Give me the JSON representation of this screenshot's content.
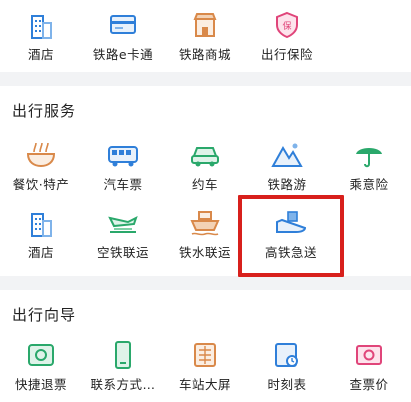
{
  "top_row": [
    {
      "label": "酒店",
      "icon": "hotel-icon"
    },
    {
      "label": "铁路e卡通",
      "icon": "railway-card-icon"
    },
    {
      "label": "铁路商城",
      "icon": "railway-mall-icon"
    },
    {
      "label": "出行保险",
      "icon": "travel-insurance-icon"
    }
  ],
  "travel_services": {
    "title": "出行服务",
    "row1": [
      {
        "label": "餐饮·特产",
        "icon": "food-icon"
      },
      {
        "label": "汽车票",
        "icon": "bus-ticket-icon"
      },
      {
        "label": "约车",
        "icon": "car-icon"
      },
      {
        "label": "铁路游",
        "icon": "railway-tour-icon"
      },
      {
        "label": "乘意险",
        "icon": "umbrella-icon"
      }
    ],
    "row2": [
      {
        "label": "酒店",
        "icon": "hotel-icon"
      },
      {
        "label": "空铁联运",
        "icon": "air-rail-icon"
      },
      {
        "label": "铁水联运",
        "icon": "rail-water-icon"
      },
      {
        "label": "高铁急送",
        "icon": "express-delivery-icon"
      }
    ]
  },
  "travel_guide": {
    "title": "出行向导",
    "items": [
      {
        "label": "快捷退票",
        "icon": "quick-refund-icon"
      },
      {
        "label": "联系方式…",
        "icon": "contact-phone-icon"
      },
      {
        "label": "车站大屏",
        "icon": "station-screen-icon"
      },
      {
        "label": "时刻表",
        "icon": "timetable-icon"
      },
      {
        "label": "查票价",
        "icon": "fare-icon"
      }
    ]
  },
  "colors": {
    "blue": "#2f7fd9",
    "green": "#2aa86b",
    "orange": "#d9894a",
    "red": "#e0457a",
    "highlight": "#d8201c"
  }
}
